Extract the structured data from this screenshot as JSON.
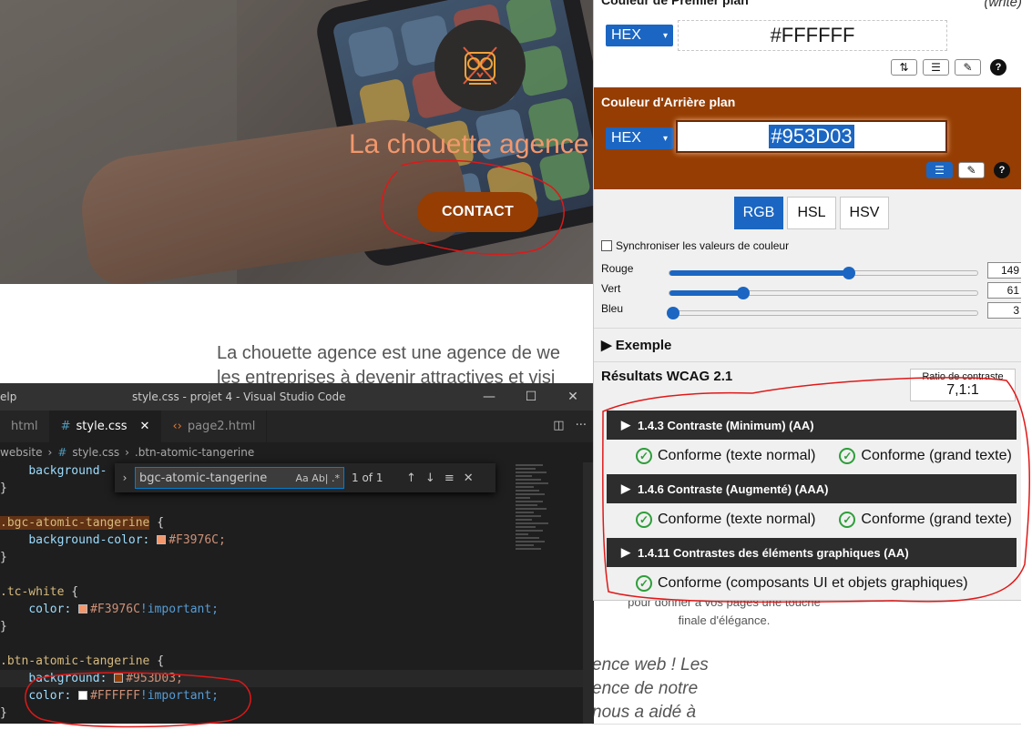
{
  "website": {
    "hero_title": "La chouette agence",
    "contact_button": "CONTACT",
    "body_line1": "La chouette agence est une agence de we",
    "body_line2": "les entreprises à devenir attractives et visi",
    "small_line1": "pour donner à vos pages une touche",
    "small_line2": "finale d'élégance.",
    "italic_line1": "ence web ! Les",
    "italic_line2": "ence de notre",
    "italic_line3": "nous a aidé à"
  },
  "vscode": {
    "menu_label": "Help",
    "menu_visible": "elp",
    "window_title": "style.css - projet 4 - Visual Studio Code",
    "tabs": [
      {
        "label": "html",
        "icon": "html-file-icon"
      },
      {
        "label": "style.css",
        "icon": "css-file-icon",
        "active": true
      },
      {
        "label": "page2.html",
        "icon": "html-file-icon"
      }
    ],
    "breadcrumb": [
      "website",
      "style.css",
      ".btn-atomic-tangerine"
    ],
    "find": {
      "query": "bgc-atomic-tangerine",
      "options": "Aa  Ab|  .*",
      "count": "1 of 1"
    },
    "code": {
      "l0_prop": "background-",
      "l1": "}",
      "l3_sel": ".bgc-atomic-tangerine",
      "l3_brace": " {",
      "l4_prop": "background-color:",
      "l4_val": "#F3976C;",
      "l5": "}",
      "l7_sel": ".tc-white",
      "l7_brace": " {",
      "l8_prop": "color:",
      "l8_val": "#F3976C",
      "l8_imp": "!important;",
      "l9": "}",
      "l11_sel": ".btn-atomic-tangerine",
      "l11_brace": " {",
      "l12_prop": "background:",
      "l12_val": "#953D03;",
      "l13_prop": "color:",
      "l13_val": "#FFFFFF",
      "l13_imp": "!important;",
      "l14": "}"
    }
  },
  "contrast_panel": {
    "foreground": {
      "title": "Couleur de Premier plan",
      "hint": "(write)",
      "format": "HEX",
      "value": "#FFFFFF"
    },
    "background": {
      "title": "Couleur d'Arrière plan",
      "format": "HEX",
      "value": "#953D03"
    },
    "modes": [
      "RGB",
      "HSL",
      "HSV"
    ],
    "active_mode": "RGB",
    "sync_label": "Synchroniser les valeurs de couleur",
    "sliders": [
      {
        "label": "Rouge",
        "value": 149,
        "max": 255
      },
      {
        "label": "Vert",
        "value": 61,
        "max": 255
      },
      {
        "label": "Bleu",
        "value": 3,
        "max": 255
      }
    ],
    "exemple_label": "▶  Exemple",
    "wcag_title": "Résultats WCAG 2.1",
    "ratio_label": "Ratio de contraste",
    "ratio_value": "7,1:1",
    "criteria": [
      {
        "title": "1.4.3 Contraste (Minimum) (AA)",
        "results": [
          "Conforme (texte normal)",
          "Conforme (grand texte)"
        ]
      },
      {
        "title": "1.4.6 Contraste (Augmenté) (AAA)",
        "results": [
          "Conforme (texte normal)",
          "Conforme (grand texte)"
        ]
      },
      {
        "title": "1.4.11 Contrastes des éléments graphiques (AA)",
        "results": [
          "Conforme (composants UI et objets graphiques)"
        ]
      }
    ]
  },
  "colors": {
    "brand_orange": "#953D03",
    "tangerine": "#F3976C",
    "accent_blue": "#1B66C2",
    "annotation_red": "#E01818"
  }
}
